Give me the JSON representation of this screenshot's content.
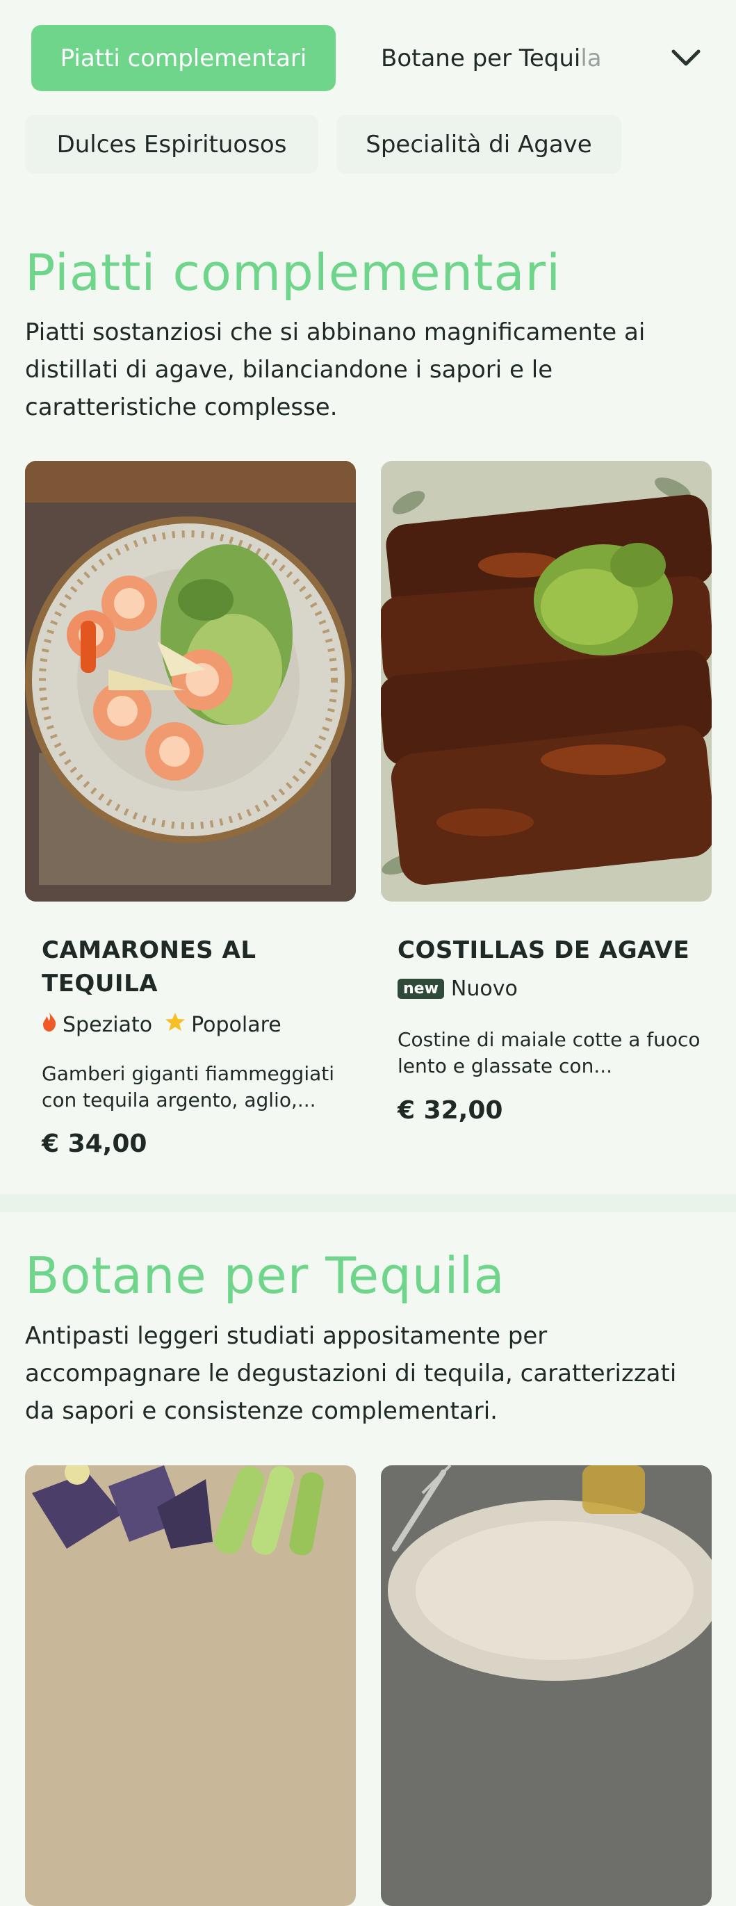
{
  "nav": {
    "active_category": "Piatti complementari",
    "next_category": "Botane per Tequi",
    "next_category_fade": "la",
    "more_categories": [
      "Dulces Espirituosos",
      "Specialità di Agave"
    ]
  },
  "sections": [
    {
      "title": "Piatti complementari",
      "description": "Piatti sostanziosi che si abbinano magnificamente ai distillati di agave, bilanciandone i sapori e le caratteristiche complesse.",
      "items": [
        {
          "name": "CAMARONES AL TEQUILA",
          "tags": [
            {
              "icon": "flame-icon",
              "label": "Speziato"
            },
            {
              "icon": "star-icon",
              "label": "Popolare"
            }
          ],
          "description": "Gamberi giganti fiammeggiati con tequila argento, aglio,...",
          "price": "€ 34,00"
        },
        {
          "name": "COSTILLAS DE AGAVE",
          "badge": "new",
          "badge_label": "Nuovo",
          "description": "Costine di maiale cotte a fuoco lento e glassate con...",
          "price": "€ 32,00"
        }
      ]
    },
    {
      "title": "Botane per Tequila",
      "description": "Antipasti leggeri studiati appositamente per accompagnare le degustazioni di tequila, caratterizzati da sapori e consistenze complementari."
    }
  ],
  "colors": {
    "accent": "#6ed58b",
    "background": "#f3f8f3",
    "text": "#1f2a26",
    "badge": "#2f4a38"
  }
}
